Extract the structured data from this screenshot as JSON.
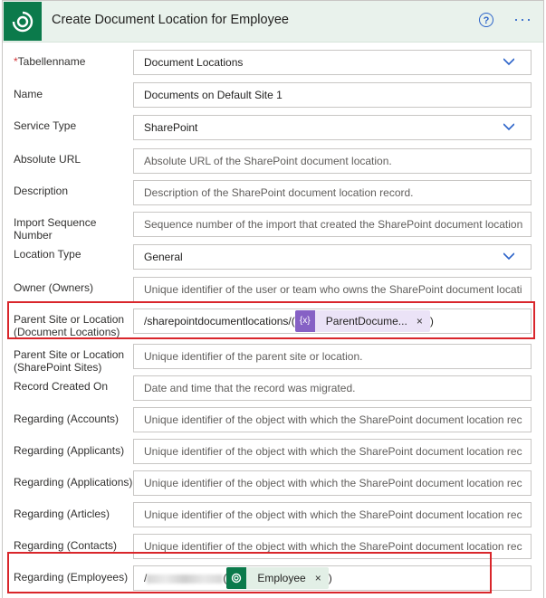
{
  "header": {
    "title": "Create Document Location for Employee",
    "help_glyph": "?",
    "more_glyph": "···"
  },
  "fields": [
    {
      "label": "Tabellenname",
      "required": true,
      "value": "Document Locations",
      "type": "dropdown"
    },
    {
      "label": "Name",
      "value": "Documents on Default Site 1"
    },
    {
      "label": "Service Type",
      "value": "SharePoint",
      "type": "dropdown"
    },
    {
      "label": "Absolute URL",
      "placeholder": "Absolute URL of the SharePoint document location."
    },
    {
      "label": "Description",
      "placeholder": "Description of the SharePoint document location record."
    },
    {
      "label": "Import Sequence Number",
      "placeholder": "Sequence number of the import that created the SharePoint document location"
    },
    {
      "label": "Location Type",
      "value": "General",
      "type": "dropdown"
    },
    {
      "label": "Owner (Owners)",
      "placeholder": "Unique identifier of the user or team who owns the SharePoint document locati"
    },
    {
      "label": "Parent Site or Location (Document Locations)",
      "prefix": "/sharepointdocumentlocations/(",
      "token": "ParentDocume...",
      "suffix": ")"
    },
    {
      "label": "Parent Site or Location (SharePoint Sites)",
      "placeholder": "Unique identifier of the parent site or location."
    },
    {
      "label": "Record Created On",
      "placeholder": "Date and time that the record was migrated."
    },
    {
      "label": "Regarding (Accounts)",
      "placeholder": "Unique identifier of the object with which the SharePoint document location rec"
    },
    {
      "label": "Regarding (Applicants)",
      "placeholder": "Unique identifier of the object with which the SharePoint document location rec"
    },
    {
      "label": "Regarding (Applications)",
      "placeholder": "Unique identifier of the object with which the SharePoint document location rec"
    },
    {
      "label": "Regarding (Articles)",
      "placeholder": "Unique identifier of the object with which the SharePoint document location rec"
    },
    {
      "label": "Regarding (Contacts)",
      "placeholder": "Unique identifier of the object with which the SharePoint document location rec"
    },
    {
      "label": "Regarding (Employees)",
      "prefix": "/",
      "suffix_open": "(",
      "token": "Employee",
      "suffix": ")"
    }
  ],
  "token_close_glyph": "×",
  "colors": {
    "accent": "#2b63c9",
    "brand": "#0b7a4b",
    "highlight": "#d9262b",
    "token_purple": "#8661c5"
  }
}
